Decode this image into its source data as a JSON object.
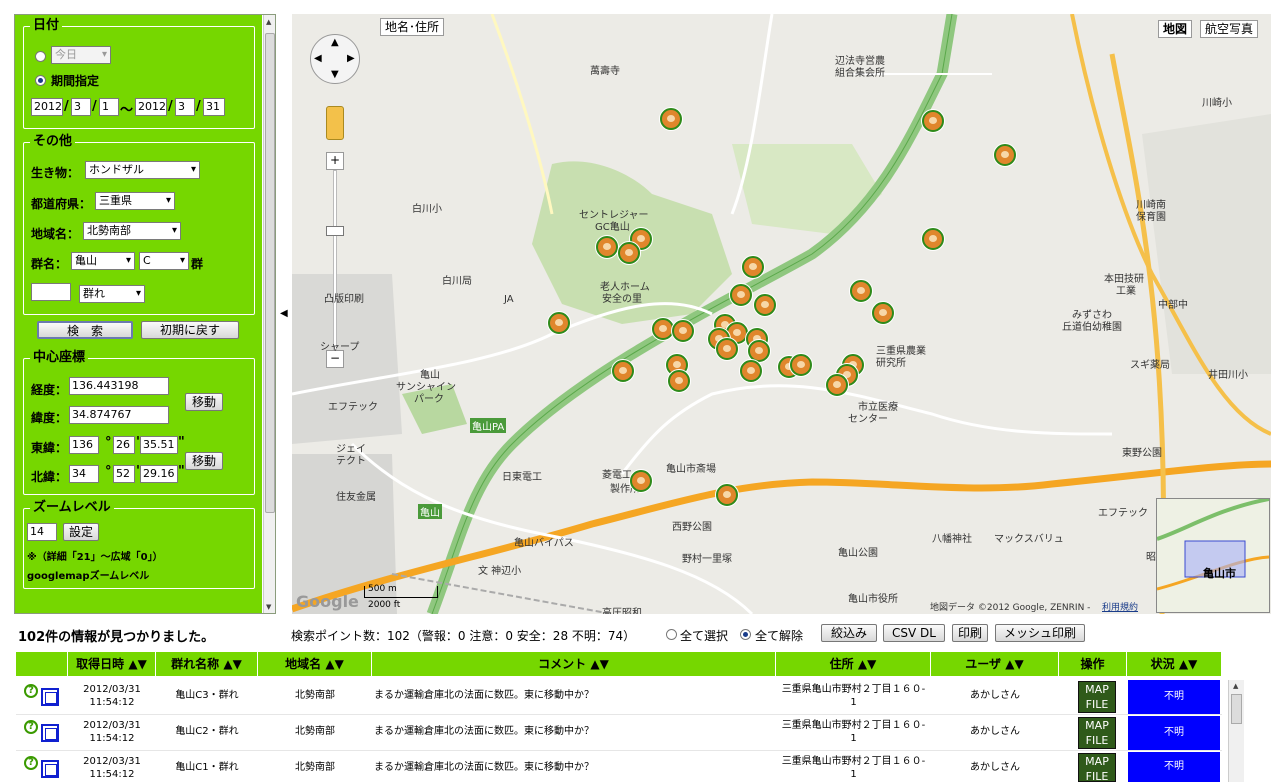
{
  "sidebar": {
    "date_legend": "日付",
    "today_select": "今日",
    "period_label": "期間指定",
    "date_from": {
      "year": "2012",
      "month": "3",
      "day": "1"
    },
    "date_to": {
      "year": "2012",
      "month": "3",
      "day": "31"
    },
    "slash": "/",
    "tilde": "～",
    "other_legend": "その他",
    "creature_label": "生き物：",
    "creature_value": "ホンドザル",
    "pref_label": "都道府県：",
    "pref_value": "三重県",
    "area_label": "地域名：",
    "area_value": "北勢南部",
    "group_label": "群名：",
    "group_value": "亀山",
    "group_sub": "C",
    "group_suffix": "群",
    "type_value": "群れ",
    "search_button": "検　索",
    "reset_button": "初期に戻す",
    "center_legend": "中心座標",
    "lon_label": "経度：",
    "lon_value": "136.443198",
    "lat_label": "緯度：",
    "lat_value": "34.874767",
    "move_button": "移動",
    "east_label": "東緯：",
    "east_deg": "136",
    "east_min": "26",
    "east_sec": "35.51",
    "north_label": "北緯：",
    "north_deg": "34",
    "north_min": "52",
    "north_sec": "29.16",
    "deg_sym": "°",
    "min_sym": "'",
    "sec_sym": "\"",
    "zoom_legend": "ズームレベル",
    "zoom_value": "14",
    "set_button": "設定",
    "zoom_note": "※（詳細「21」～広域「0」）",
    "zoom_note2": "googlemapズームレベル"
  },
  "map": {
    "place_button": "地名･住所",
    "map_button": "地図",
    "aerial_button": "航空写真",
    "labels": [
      "萬壽寺",
      "辺法寺営農",
      "組合集会所",
      "白川小",
      "白川局",
      "セントレジャー",
      "GC亀山",
      "老人ホーム",
      "安全の里",
      "凸版印刷",
      "JA",
      "シャープ",
      "亀山",
      "サンシャイン",
      "パーク",
      "エフテック",
      "ジェイ",
      "テクト",
      "日東電工",
      "住友金属",
      "菱電工",
      "製作所",
      "亀山市斎場",
      "西野公園",
      "三重県農業",
      "研究所",
      "市立医療",
      "センター",
      "本田技研",
      "工業",
      "みずさわ",
      "丘道伯幼稚園",
      "スギ薬局",
      "東野公園",
      "亀山公園",
      "亀山市役所",
      "文 神辺小",
      "高圧昭和",
      "野村一里塚",
      "八幡神社",
      "マックスバリュ",
      "川崎南",
      "保育園",
      "中部中",
      "井田川小",
      "昭和",
      "エフテック",
      "亀山PA",
      "亀山",
      "亀山バイパス",
      "亀山市",
      "川崎小"
    ],
    "scale_m": "500 m",
    "scale_ft": "2000 ft",
    "google": "Google",
    "copyright": "地図データ ©2012 Google, ZENRIN - ",
    "terms": "利用規約"
  },
  "summary": "102件の情報が見つかりました。",
  "search_info": {
    "text": "検索ポイント数：102（警報：0 注意：0 安全：28 不明：74）",
    "select_all": "全て選択",
    "deselect_all": "全て解除",
    "narrow": "絞込み",
    "csv": "CSV DL",
    "print": "印刷",
    "mesh_print": "メッシュ印刷"
  },
  "table": {
    "headers": [
      "取得日時 ▲▼",
      "群れ名称 ▲▼",
      "地域名 ▲▼",
      "コメント ▲▼",
      "住所 ▲▼",
      "ユーザ ▲▼",
      "操作",
      "状況 ▲▼"
    ],
    "rows": [
      {
        "date": "2012/03/31",
        "time": "11:54:12",
        "group": "亀山C3・群れ",
        "area": "北勢南部",
        "comment": "まるか運輸倉庫北の法面に数匹。東に移動中か？",
        "addr1": "三重県亀山市野村２丁目１６０-",
        "addr2": "1",
        "user": "あかしさん",
        "map": "MAP",
        "file": "FILE",
        "status": "不明"
      },
      {
        "date": "2012/03/31",
        "time": "11:54:12",
        "group": "亀山C2・群れ",
        "area": "北勢南部",
        "comment": "まるか運輸倉庫北の法面に数匹。東に移動中か？",
        "addr1": "三重県亀山市野村２丁目１６０-",
        "addr2": "1",
        "user": "あかしさん",
        "map": "MAP",
        "file": "FILE",
        "status": "不明"
      },
      {
        "date": "2012/03/31",
        "time": "11:54:12",
        "group": "亀山C1・群れ",
        "area": "北勢南部",
        "comment": "まるか運輸倉庫北の法面に数匹。東に移動中か？",
        "addr1": "三重県亀山市野村２丁目１６０-",
        "addr2": "1",
        "user": "あかしさん",
        "map": "MAP",
        "file": "FILE",
        "status": "不明"
      }
    ]
  },
  "colors": {
    "panel": "#76d700",
    "status": "#0000ff",
    "marker_ring": "#2f8a1a"
  }
}
